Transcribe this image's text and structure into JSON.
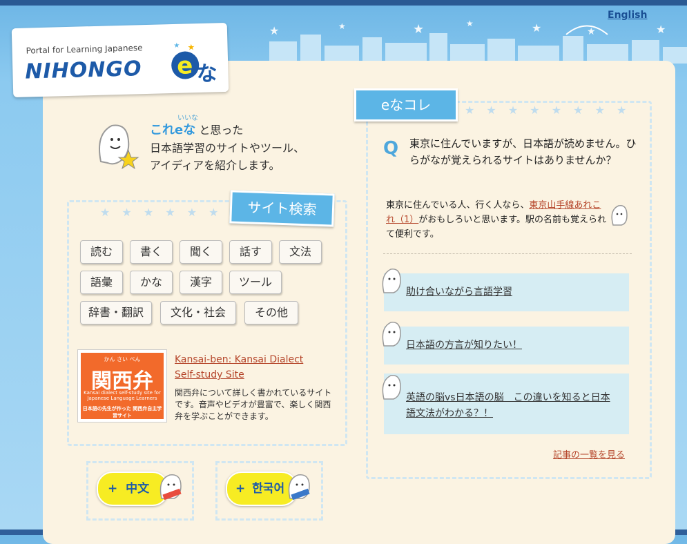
{
  "header": {
    "language_link": "English",
    "logo_subtitle": "Portal for Learning Japanese",
    "logo_text": "NIHONGO",
    "logo_e": "e",
    "logo_na": "な"
  },
  "intro": {
    "ruby": "いいな",
    "highlight": "これeな",
    "line1_rest": "と思った",
    "line2": "日本語学習のサイトやツール、",
    "line3": "アイディアを紹介します。"
  },
  "site_search": {
    "title": "サイト検索",
    "buttons": [
      "読む",
      "書く",
      "聞く",
      "話す",
      "文法",
      "語彙",
      "かな",
      "漢字",
      "ツール",
      "辞書・翻訳",
      "文化・社会",
      "その他"
    ]
  },
  "featured_site": {
    "banner_furigana": "かん さい べん",
    "banner_title": "関西弁",
    "banner_subtitle": "Kansai dialect self-study site for Japanese Language Learners",
    "banner_caption": "日本語の先生が作った 関西弁自主学習サイト",
    "link_text": "Kansai-ben: Kansai Dialect Self-study Site",
    "description": "関西弁について詳しく書かれているサイトです。音声やビデオが豊富で、楽しく関西弁を学ぶことができます。"
  },
  "language_buttons": [
    {
      "label": "中文",
      "plus": "+"
    },
    {
      "label": "한국어",
      "plus": "+"
    }
  ],
  "ena_kore": {
    "title": "eなコレ",
    "q_mark": "Q",
    "question": "東京に住んでいますが、日本語が読めません。ひらがなが覚えられるサイトはありませんか？",
    "answer_before": "東京に住んでいる人、行く人なら、",
    "answer_link": "東京山手線あれこれ（1）",
    "answer_after": "がおもしろいと思います。駅の名前も覚えられて便利です。",
    "articles": [
      "助け合いながら言語学習",
      "日本語の方言が知りたい！",
      "英語の脳vs日本語の脳　この違いを知ると日本語文法がわかる？！"
    ],
    "more_link": "記事の一覧を見る"
  },
  "colors": {
    "sky": "#8ccaf0",
    "panel": "#fbf3e2",
    "accent_blue": "#5cb5e6",
    "logo_blue": "#1d5aa8",
    "link_red": "#b5452a",
    "yellow": "#f7ec23",
    "banner_orange": "#f26a2b",
    "article_bg": "#d6edf3"
  }
}
